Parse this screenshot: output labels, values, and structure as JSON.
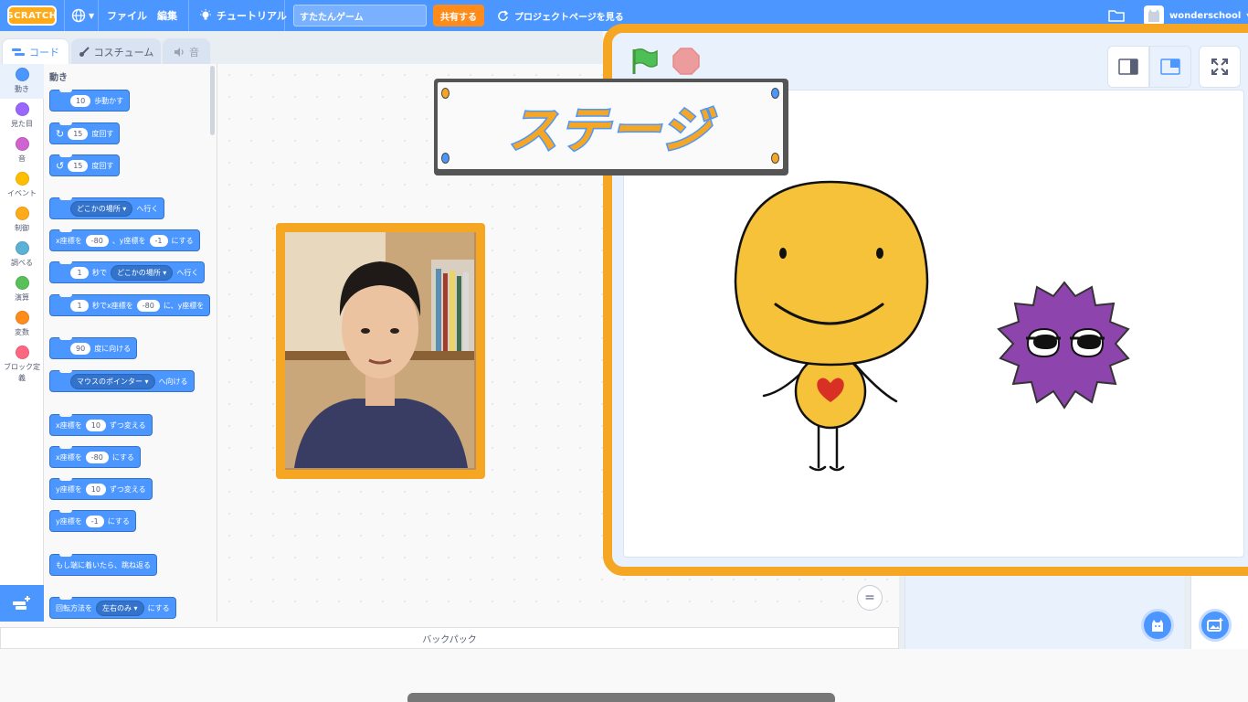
{
  "menubar": {
    "logo": "SCRATCH",
    "file": "ファイル",
    "edit": "編集",
    "tutorial": "チュートリアル",
    "project_title": "すたたんゲーム",
    "share": "共有する",
    "see_project_page": "プロジェクトページを見る",
    "username": "wonderschool"
  },
  "tabs": {
    "code": "コード",
    "costumes": "コスチューム",
    "sounds": "音"
  },
  "categories": [
    {
      "label": "動き",
      "color": "#4c97ff"
    },
    {
      "label": "見た目",
      "color": "#9966ff"
    },
    {
      "label": "音",
      "color": "#cf63cf"
    },
    {
      "label": "イベント",
      "color": "#ffbf00"
    },
    {
      "label": "制御",
      "color": "#ffab19"
    },
    {
      "label": "調べる",
      "color": "#5cb1d6"
    },
    {
      "label": "演算",
      "color": "#59c059"
    },
    {
      "label": "変数",
      "color": "#ff8c1a"
    },
    {
      "label": "ブロック定義",
      "color": "#ff6680"
    }
  ],
  "palette": {
    "heading": "動き",
    "move": {
      "value": "10",
      "text": "歩動かす"
    },
    "turn_right": {
      "value": "15",
      "text": "度回す"
    },
    "turn_left": {
      "value": "15",
      "text": "度回す"
    },
    "goto": {
      "menu": "どこかの場所",
      "text": "へ行く"
    },
    "goto_xy": {
      "x_label": "x座標を",
      "x": "-80",
      "sep": "、y座標を",
      "y": "-1",
      "text": "にする"
    },
    "glide_to": {
      "secs": "1",
      "label": "秒で",
      "menu": "どこかの場所",
      "text": "へ行く"
    },
    "glide_xy": {
      "secs": "1",
      "label": "秒でx座標を",
      "x": "-80",
      "text": "に、y座標を"
    },
    "point_direction": {
      "value": "90",
      "text": "度に向ける"
    },
    "point_towards": {
      "menu": "マウスのポインター",
      "text": "へ向ける"
    },
    "change_x": {
      "label": "x座標を",
      "value": "10",
      "text": "ずつ変える"
    },
    "set_x": {
      "label": "x座標を",
      "value": "-80",
      "text": "にする"
    },
    "change_y": {
      "label": "y座標を",
      "value": "10",
      "text": "ずつ変える"
    },
    "set_y": {
      "label": "y座標を",
      "value": "-1",
      "text": "にする"
    },
    "bounce": "もし端に着いたら、跳ね返る",
    "rotation_style": {
      "label": "回転方法を",
      "menu": "左右のみ",
      "text": "にする"
    }
  },
  "zoom_reset": "=",
  "backpack": "バックパック",
  "stage_label": "ステージ",
  "colors": {
    "menubar": "#4c97ff",
    "accent_orange": "#f5a623",
    "share": "#ff8c1a",
    "motion": "#4c97ff"
  }
}
